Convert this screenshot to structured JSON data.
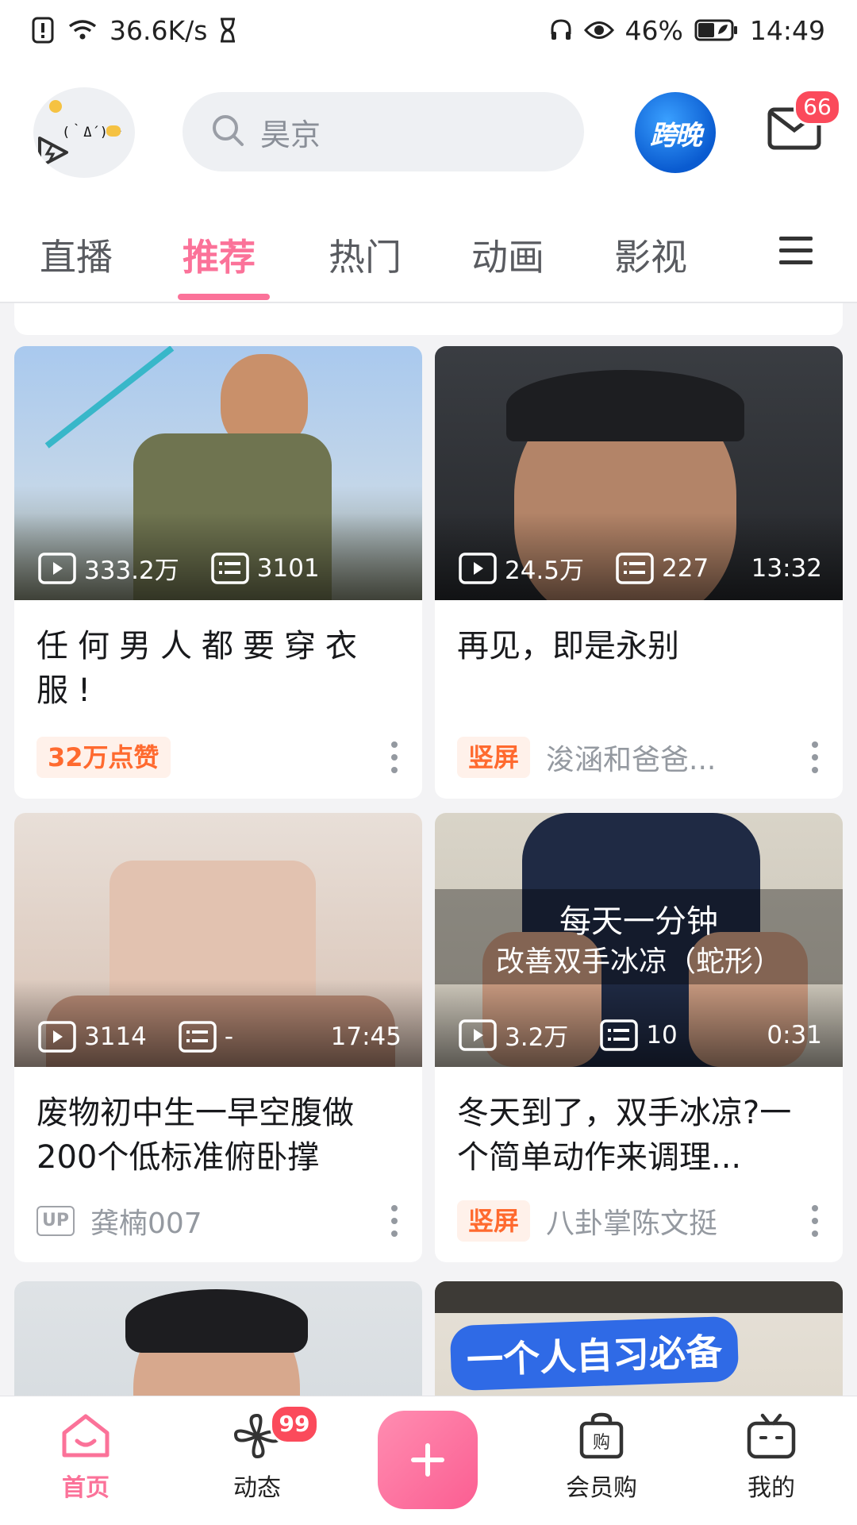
{
  "status_bar": {
    "speed": "36.6K/s",
    "battery": "46%",
    "time": "14:49"
  },
  "header": {
    "avatar_kaomoji": "(｀Δ´)一",
    "search_placeholder": "昊京",
    "topic_badge": "跨晚",
    "mail_count": "66"
  },
  "tabs": [
    "直播",
    "推荐",
    "热门",
    "动画",
    "影视"
  ],
  "active_tab": "推荐",
  "cards": [
    {
      "views": "333.2万",
      "danmaku": "3101",
      "duration": "",
      "title": "任何男人都要穿衣服!",
      "tag": "32万点赞",
      "up_badge": "",
      "author": ""
    },
    {
      "views": "24.5万",
      "danmaku": "227",
      "duration": "13:32",
      "title": "再见，即是永别",
      "tag": "竖屏",
      "up_badge": "",
      "author": "浚涵和爸爸..."
    },
    {
      "views": "3114",
      "danmaku": "-",
      "duration": "17:45",
      "title": "废物初中生一早空腹做200个低标准俯卧撑",
      "tag": "",
      "up_badge": "UP",
      "author": "龚楠007"
    },
    {
      "views": "3.2万",
      "danmaku": "10",
      "duration": "0:31",
      "title": "冬天到了，双手冰凉?一个简单动作来调理...",
      "tag": "竖屏",
      "up_badge": "",
      "author": "八卦掌陈文挺",
      "thumb_caption_1": "每天一分钟",
      "thumb_caption_2": "改善双手冰凉（蛇形）"
    },
    {
      "views": "",
      "danmaku": "",
      "duration": "",
      "title": "",
      "tag": "",
      "author": ""
    },
    {
      "views": "",
      "danmaku": "",
      "duration": "",
      "title": "",
      "tag": "",
      "author": "",
      "thumb_banner": "一个人自习必备"
    }
  ],
  "bottom_nav": {
    "home": "首页",
    "dynamic": "动态",
    "dynamic_badge": "99",
    "vip_shop": "会员购",
    "mine": "我的"
  },
  "colors": {
    "accent_pink": "#fb7299",
    "tag_orange": "#ff6a2f",
    "badge_red": "#fb4a5b",
    "meta_gray": "#9499a0"
  }
}
